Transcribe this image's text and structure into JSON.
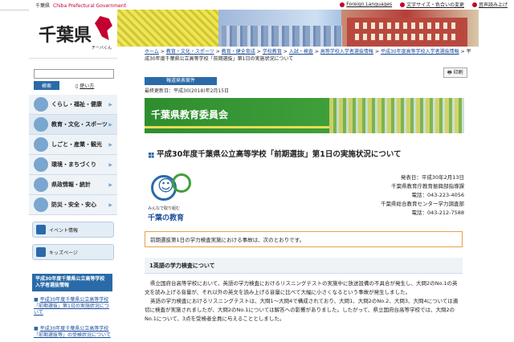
{
  "topbar": {
    "site_jp": "千葉県",
    "site_en": "Chiba Prefectural Government",
    "links": [
      "Foreign Languages",
      "文字サイズ・色合いの変更",
      "音声読み上げ"
    ]
  },
  "logo": {
    "name": "千葉県",
    "kana": "チーバくん"
  },
  "search": {
    "placeholder": "",
    "button": "検索",
    "help": "使い方"
  },
  "menu": [
    {
      "label": "くらし・福祉・健康",
      "icon": "house-icon"
    },
    {
      "label": "教育・文化・スポーツ",
      "icon": "pencil-icon"
    },
    {
      "label": "しごと・産業・観光",
      "icon": "briefcase-icon"
    },
    {
      "label": "環境・まちづくり",
      "icon": "leaf-icon"
    },
    {
      "label": "県政情報・統計",
      "icon": "building-icon"
    },
    {
      "label": "防災・安全・安心",
      "icon": "heart-icon"
    }
  ],
  "side_pills": [
    "イベント情報",
    "キッズページ"
  ],
  "side_section": {
    "title": "平成30年度千葉県公立高等学校入学者選抜情報",
    "links": [
      "平成30年度千葉県公立高等学校「前期選抜」第1日の実施状況について",
      "平成30年度千葉県公立高等学校「前期選抜等」の受検状況について"
    ]
  },
  "breadcrumb": {
    "links": [
      "ホーム",
      "教育・文化・スポーツ",
      "教育・健全育成",
      "学校教育",
      "入試・検査",
      "高等学校入学者選抜情報",
      "平成30年度高等学校入学者選抜情報"
    ],
    "current": "平成30年度千葉県公立高等学校「前期選抜」第1日の実施状況について"
  },
  "article": {
    "tag": "報道発表案件",
    "updated": "最終更新日：平成30(2018)年2月15日",
    "print": "印刷",
    "banner_title": "千葉県教育委員会",
    "title": "平成30年度千葉県公立高等学校「前期選抜」第1日の実施状況について",
    "edu_slogan": "みんなで取り組む",
    "edu_brand": "千葉の教育",
    "edu_mark": "Education",
    "release_date": "発表日：平成30年2月13日",
    "contact1_org": "千葉県教育庁教育振興部指導課",
    "contact1_tel": "電話：043-223-4056",
    "contact2_org": "千葉県総合教育センター学力調査部",
    "contact2_tel": "電話：043-212-7588",
    "notice": "前期選抜第1日の学力検査実施における事故は、次のとおりです。",
    "section_title": "1英語の学力検査について",
    "paragraph1": "県立国府台高等学校において、英語の学力検査におけるリスニングテストの実施中に放送設備の不具合が発生し、大問2のNo.1の英文を読み上げる音量が、それ以外の英文を読み上げる音量に比べて大幅に小さくなるという事故が発生しました。",
    "paragraph2": "英語の学力検査におけるリスニングテストは、大問1～大問4で構成されており、大問1、大問2のNo.2、大問3、大問4については適切に検査が実施されましたが、大問2のNo.1については解答への影響がありました。したがって、県立国府台高等学校では、大問2のNo.1について、3点を受検者全員に与えることとしました。"
  }
}
